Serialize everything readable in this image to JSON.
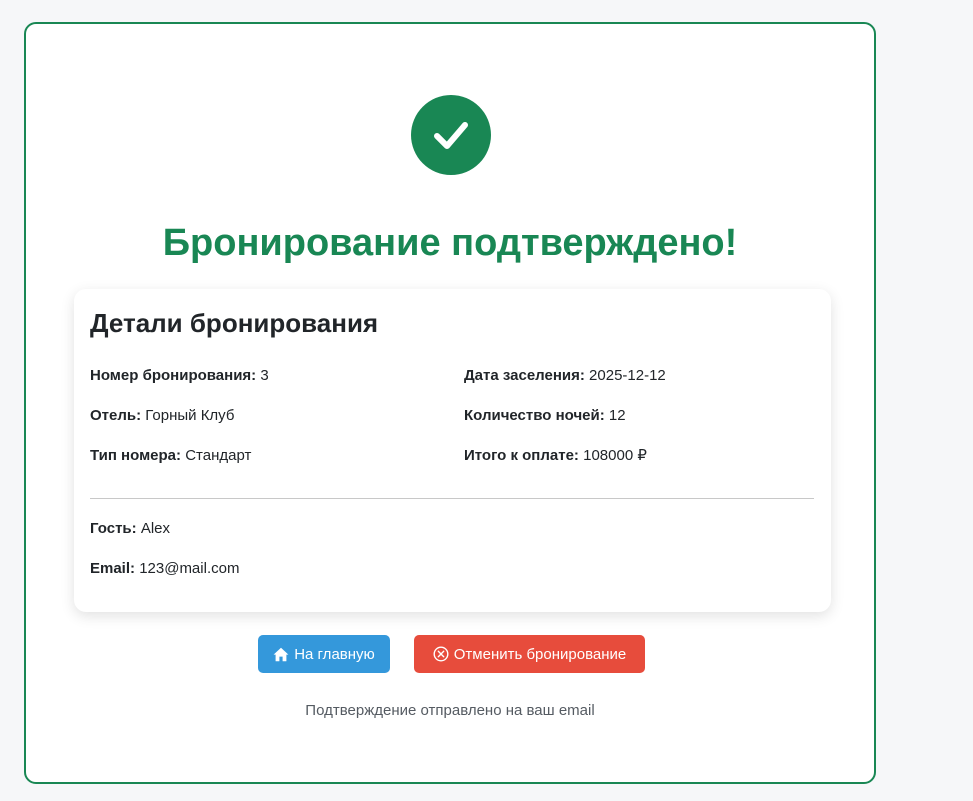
{
  "page": {
    "title": "Бронирование подтверждено!",
    "accent_color": "#198754",
    "success_icon": "check-circle-icon"
  },
  "details": {
    "heading": "Детали бронирования",
    "booking_number": {
      "label": "Номер бронирования:",
      "value": "3"
    },
    "hotel": {
      "label": "Отель:",
      "value": "Горный Клуб"
    },
    "room_type": {
      "label": "Тип номера:",
      "value": "Стандарт"
    },
    "checkin_date": {
      "label": "Дата заселения:",
      "value": "2025-12-12"
    },
    "nights": {
      "label": "Количество ночей:",
      "value": "12"
    },
    "total": {
      "label": "Итого к оплате:",
      "value": "108000 ₽"
    },
    "guest": {
      "label": "Гость:",
      "value": "Alex"
    },
    "email": {
      "label": "Email:",
      "value": "123@mail.com"
    }
  },
  "actions": {
    "home": {
      "label": "На главную",
      "icon": "house-icon",
      "color": "#3498db"
    },
    "cancel": {
      "label": "Отменить бронирование",
      "icon": "x-circle-icon",
      "color": "#e74c3c"
    }
  },
  "footer": {
    "note": "Подтверждение отправлено на ваш email"
  }
}
